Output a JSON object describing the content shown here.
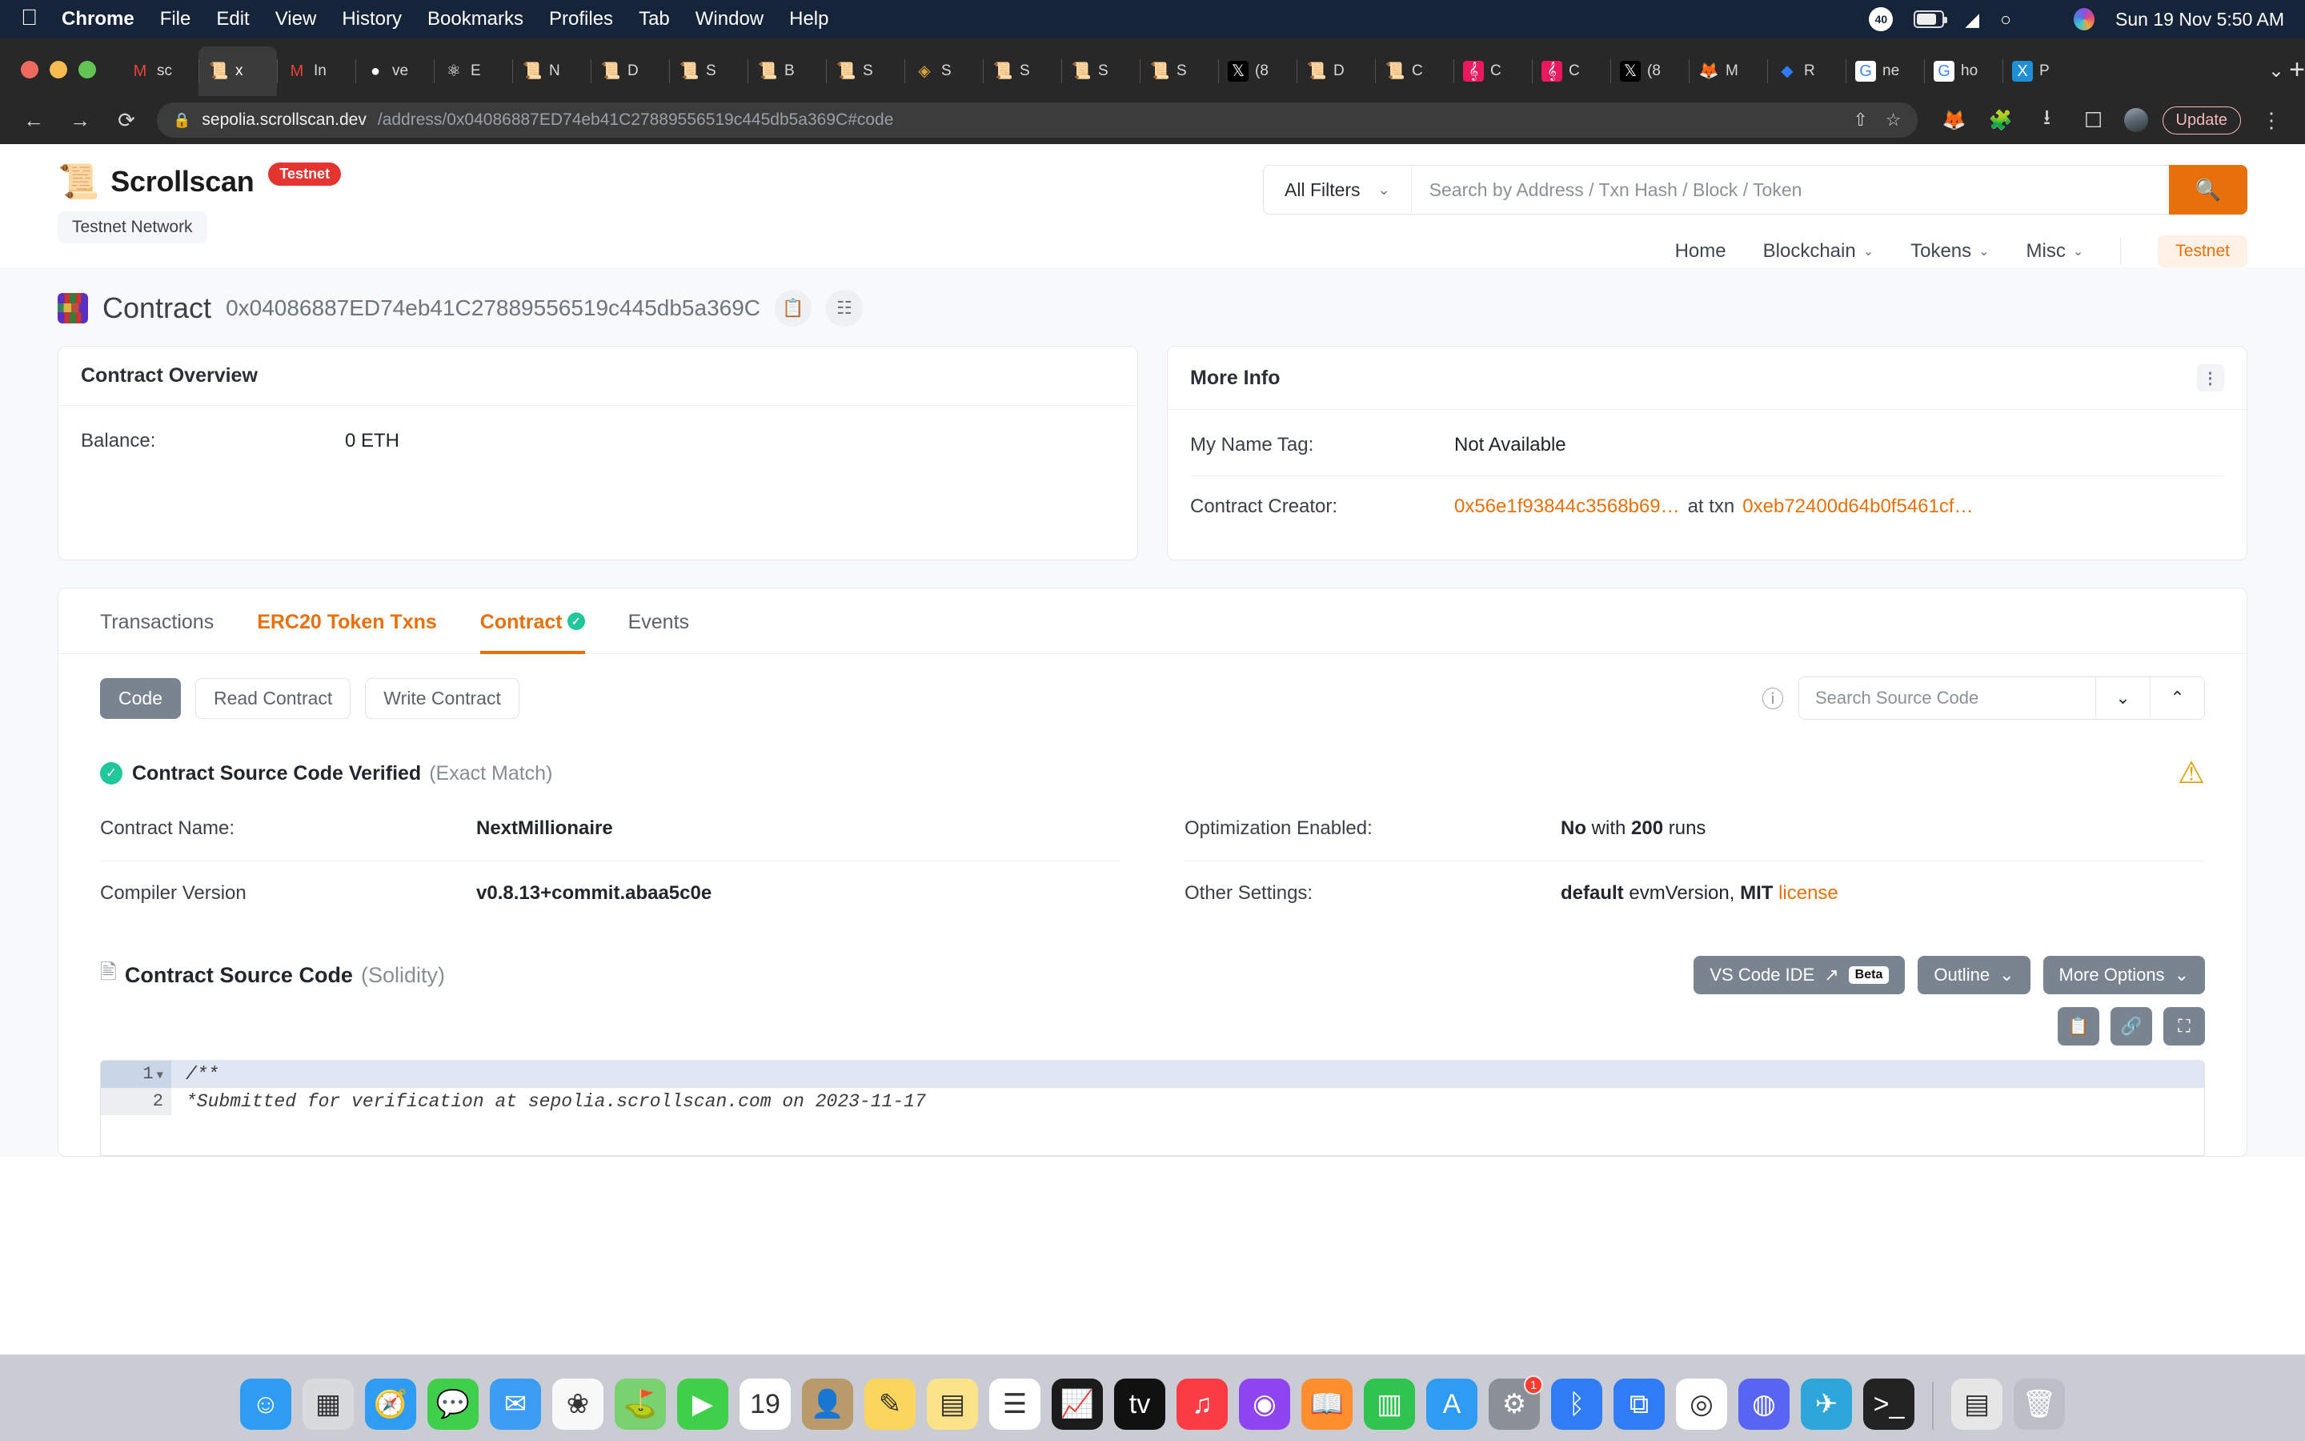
{
  "os_menu": {
    "apple": "",
    "items": [
      "Chrome",
      "File",
      "Edit",
      "View",
      "History",
      "Bookmarks",
      "Profiles",
      "Tab",
      "Window",
      "Help"
    ],
    "battery_percent": "40",
    "clock": "Sun 19 Nov  5:50 AM"
  },
  "browser": {
    "tabs": [
      {
        "icon": "gmail",
        "title": "sc"
      },
      {
        "icon": "scroll",
        "title": "x",
        "active": true
      },
      {
        "icon": "gmail",
        "title": "In"
      },
      {
        "icon": "github",
        "title": "ve"
      },
      {
        "icon": "atom",
        "title": "E"
      },
      {
        "icon": "scroll",
        "title": "N"
      },
      {
        "icon": "scroll",
        "title": "D"
      },
      {
        "icon": "scroll",
        "title": "S"
      },
      {
        "icon": "scroll",
        "title": "B"
      },
      {
        "icon": "scroll",
        "title": "S"
      },
      {
        "icon": "diamond",
        "title": "S"
      },
      {
        "icon": "scroll",
        "title": "S"
      },
      {
        "icon": "scroll",
        "title": "S"
      },
      {
        "icon": "scroll",
        "title": "S"
      },
      {
        "icon": "x-black",
        "title": "(8"
      },
      {
        "icon": "scroll",
        "title": "D"
      },
      {
        "icon": "scroll",
        "title": "C"
      },
      {
        "icon": "pink",
        "title": "C"
      },
      {
        "icon": "pink",
        "title": "C"
      },
      {
        "icon": "x-black",
        "title": "(8"
      },
      {
        "icon": "fox",
        "title": "M"
      },
      {
        "icon": "blue-gem",
        "title": "R"
      },
      {
        "icon": "google",
        "title": "ne"
      },
      {
        "icon": "google",
        "title": "ho"
      },
      {
        "icon": "x-blue",
        "title": "P"
      }
    ],
    "new_tab_label": "+",
    "url_domain": "sepolia.scrollscan.dev",
    "url_path": "/address/0x04086887ED74eb41C27889556519c445db5a369C#code",
    "update_label": "Update"
  },
  "site": {
    "brand": "Scrollscan",
    "brand_badge": "Testnet",
    "network_chip": "Testnet Network",
    "search": {
      "filter_label": "All Filters",
      "placeholder": "Search by Address / Txn Hash / Block / Token",
      "value": ""
    },
    "nav": [
      {
        "label": "Home",
        "caret": false
      },
      {
        "label": "Blockchain",
        "caret": true
      },
      {
        "label": "Tokens",
        "caret": true
      },
      {
        "label": "Misc",
        "caret": true
      }
    ],
    "nav_badge": "Testnet"
  },
  "title_row": {
    "label": "Contract",
    "address": "0x04086887ED74eb41C27889556519c445db5a369C"
  },
  "contract_overview": {
    "heading": "Contract Overview",
    "rows": [
      {
        "key": "Balance:",
        "value": "0 ETH"
      }
    ]
  },
  "more_info": {
    "heading": "More Info",
    "name_tag_key": "My Name Tag:",
    "name_tag_value": "Not Available",
    "creator_key": "Contract Creator:",
    "creator_address": "0x56e1f93844c3568b69…",
    "creator_at": "at txn",
    "creator_txn": "0xeb72400d64b0f5461cf…"
  },
  "page_tabs": [
    {
      "label": "Transactions",
      "style": "normal"
    },
    {
      "label": "ERC20 Token Txns",
      "style": "orange"
    },
    {
      "label": "Contract",
      "style": "active",
      "verified": true
    },
    {
      "label": "Events",
      "style": "normal"
    }
  ],
  "sub_tabs": [
    {
      "label": "Code",
      "active": true
    },
    {
      "label": "Read Contract",
      "active": false
    },
    {
      "label": "Write Contract",
      "active": false
    }
  ],
  "source_search": {
    "placeholder": "Search Source Code",
    "value": "",
    "down_caret": "⌄",
    "up_caret": "⌃"
  },
  "verification": {
    "title": "Contract Source Code Verified",
    "subtitle": "(Exact Match)",
    "left": [
      {
        "key": "Contract Name:",
        "value": "NextMillionaire"
      },
      {
        "key": "Compiler Version",
        "value": "v0.8.13+commit.abaa5c0e"
      }
    ],
    "right": [
      {
        "key": "Optimization Enabled:",
        "value_bold": "No",
        "value_mid": " with ",
        "value_bold2": "200",
        "value_tail": " runs"
      },
      {
        "key": "Other Settings:",
        "value_bold": "default",
        "value_mid": " evmVersion, ",
        "value_bold2": "MIT",
        "value_tail": " license"
      }
    ]
  },
  "source_code": {
    "title": "Contract Source Code",
    "subtitle": "(Solidity)",
    "buttons": [
      {
        "label": "VS Code IDE",
        "external": true,
        "pill": "Beta"
      },
      {
        "label": "Outline",
        "caret": true
      },
      {
        "label": "More Options",
        "caret": true
      }
    ],
    "lines": [
      {
        "num": "1",
        "text": "/**",
        "fold": true,
        "highlight": true
      },
      {
        "num": "2",
        "text": " *Submitted for verification at sepolia.scrollscan.com on 2023-11-17",
        "fold": false,
        "highlight": false
      }
    ]
  },
  "status_bar_url": "https://sepolia.scrollscan.dev/address/0x04086887ED74eb41C27889556519c445db5a369C#tokentxns",
  "dock": [
    {
      "name": "finder",
      "glyph": "☺",
      "color": "#2f9cf4"
    },
    {
      "name": "launchpad",
      "glyph": "▦",
      "color": "#d8dade"
    },
    {
      "name": "safari",
      "glyph": "🧭",
      "color": "#2f9cf4"
    },
    {
      "name": "messages",
      "glyph": "💬",
      "color": "#3fcf4a"
    },
    {
      "name": "mail",
      "glyph": "✉",
      "color": "#3b9cf4"
    },
    {
      "name": "photos",
      "glyph": "❀",
      "color": "#f8f8f8"
    },
    {
      "name": "maps",
      "glyph": "⛳",
      "color": "#79d16f"
    },
    {
      "name": "facetime",
      "glyph": "▶",
      "color": "#3fcf4a"
    },
    {
      "name": "calendar",
      "glyph": "19",
      "color": "#ffffff"
    },
    {
      "name": "contacts",
      "glyph": "👤",
      "color": "#b99a6b"
    },
    {
      "name": "notes",
      "glyph": "✎",
      "color": "#fbd65f"
    },
    {
      "name": "stickies",
      "glyph": "▤",
      "color": "#fbe38a"
    },
    {
      "name": "reminders",
      "glyph": "☰",
      "color": "#ffffff"
    },
    {
      "name": "stocks",
      "glyph": "📈",
      "color": "#1b1b1b"
    },
    {
      "name": "appletv",
      "glyph": "tv",
      "color": "#111111"
    },
    {
      "name": "music",
      "glyph": "♫",
      "color": "#fc3c44"
    },
    {
      "name": "podcasts",
      "glyph": "◉",
      "color": "#8e44ef"
    },
    {
      "name": "books",
      "glyph": "📖",
      "color": "#ff8f2e"
    },
    {
      "name": "numbers",
      "glyph": "▥",
      "color": "#2fc44f"
    },
    {
      "name": "appstore",
      "glyph": "A",
      "color": "#2f9cf4"
    },
    {
      "name": "settings",
      "glyph": "⚙",
      "color": "#8a8f98",
      "badge": "1"
    },
    {
      "name": "bluetooth",
      "glyph": "ᛒ",
      "color": "#2f7cf4"
    },
    {
      "name": "vscode",
      "glyph": "⧉",
      "color": "#2f7cf4"
    },
    {
      "name": "chrome",
      "glyph": "◎",
      "color": "#ffffff"
    },
    {
      "name": "discord",
      "glyph": "◍",
      "color": "#5865f2"
    },
    {
      "name": "telegram",
      "glyph": "✈",
      "color": "#2ea6da"
    },
    {
      "name": "terminal",
      "glyph": ">_",
      "color": "#222222"
    },
    {
      "name": "downloads-stack",
      "glyph": "▤",
      "color": "#e6e6e6"
    },
    {
      "name": "trash",
      "glyph": "🗑",
      "color": "#bcbfc6"
    }
  ]
}
